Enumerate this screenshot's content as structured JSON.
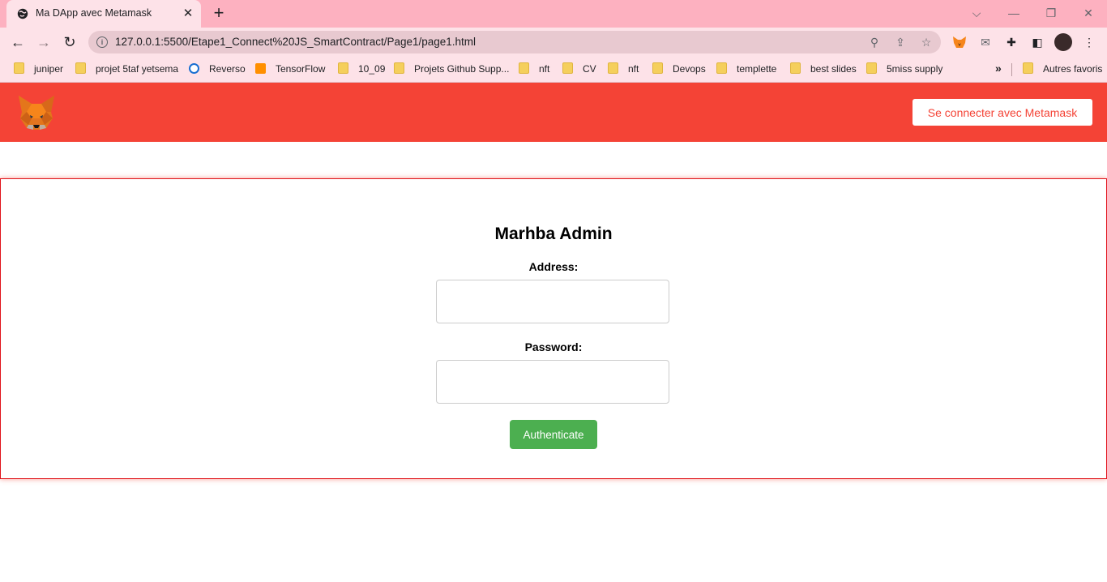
{
  "browser": {
    "tab_title": "Ma DApp avec Metamask",
    "new_tab_label": "+",
    "url": "127.0.0.1:5500/Etape1_Connect%20JS_SmartContract/Page1/page1.html",
    "bookmarks": [
      {
        "label": "juniper",
        "icon": "folder-icon"
      },
      {
        "label": "projet 5taf yetsema",
        "icon": "folder-icon"
      },
      {
        "label": "Reverso",
        "icon": "reverso-icon"
      },
      {
        "label": "TensorFlow",
        "icon": "tensorflow-icon"
      },
      {
        "label": "10_09",
        "icon": "folder-icon"
      },
      {
        "label": "Projets Github Supp...",
        "icon": "folder-icon"
      },
      {
        "label": "nft",
        "icon": "folder-icon"
      },
      {
        "label": "CV",
        "icon": "folder-icon"
      },
      {
        "label": "nft",
        "icon": "folder-icon"
      },
      {
        "label": "Devops",
        "icon": "folder-icon"
      },
      {
        "label": "templette",
        "icon": "folder-icon"
      },
      {
        "label": "best slides",
        "icon": "folder-icon"
      },
      {
        "label": "5miss supply",
        "icon": "folder-icon"
      }
    ],
    "bookmarks_more": "»",
    "other_bookmarks": "Autres favoris"
  },
  "header": {
    "connect_button": "Se connecter avec Metamask"
  },
  "form": {
    "title": "Marhba Admin",
    "address_label": "Address:",
    "address_value": "",
    "password_label": "Password:",
    "password_value": "",
    "submit_label": "Authenticate"
  },
  "colors": {
    "header_bg": "#f44336",
    "card_border": "#e0141b",
    "submit_bg": "#4caf50",
    "tabstrip_bg": "#fdb1c0",
    "toolbar_bg": "#fde2e8"
  }
}
